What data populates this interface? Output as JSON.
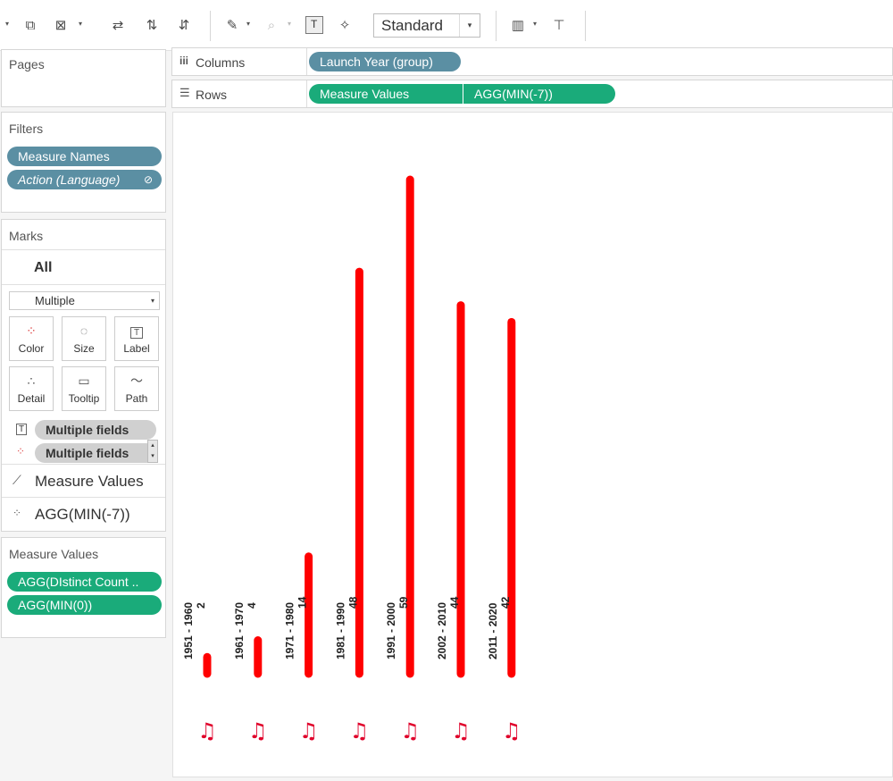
{
  "toolbar": {
    "fit_select": "Standard",
    "icons": [
      "add-datasource-icon",
      "clear-sheet-icon",
      "swap-icon",
      "sort-ascending-icon",
      "sort-descending-icon",
      "highlight-icon",
      "group-icon",
      "show-labels-icon",
      "pin-icon",
      "show-me-icon",
      "presentation-icon"
    ]
  },
  "pages": {
    "title": "Pages"
  },
  "shelves": {
    "columns_label": "Columns",
    "rows_label": "Rows",
    "columns_pills": [
      "Launch Year (group)"
    ],
    "rows_pills": [
      "Measure Values",
      "AGG(MIN(-7))"
    ]
  },
  "filters": {
    "title": "Filters",
    "items": [
      "Measure Names",
      "Action (Language)"
    ]
  },
  "marks": {
    "title": "Marks",
    "tab": "All",
    "type": "Multiple",
    "cards": [
      "Color",
      "Size",
      "Label",
      "Detail",
      "Tooltip",
      "Path"
    ],
    "field_pills": [
      "Multiple fields",
      "Multiple fields"
    ],
    "sections": [
      "Measure Values",
      "AGG(MIN(-7))"
    ]
  },
  "measure_values": {
    "title": "Measure Values",
    "items": [
      "AGG(DIstinct Count ..",
      "AGG(MIN(0))"
    ]
  },
  "chart_data": {
    "type": "bar",
    "categories": [
      "1951 - 1960",
      "1961 - 1970",
      "1971 - 1980",
      "1981 - 1990",
      "1991 - 2000",
      "2002 - 2010",
      "2011 - 2020"
    ],
    "values": [
      2,
      4,
      14,
      48,
      59,
      44,
      42
    ],
    "bar_color": "#ff0000",
    "marker_icon": "music-note-icon"
  }
}
